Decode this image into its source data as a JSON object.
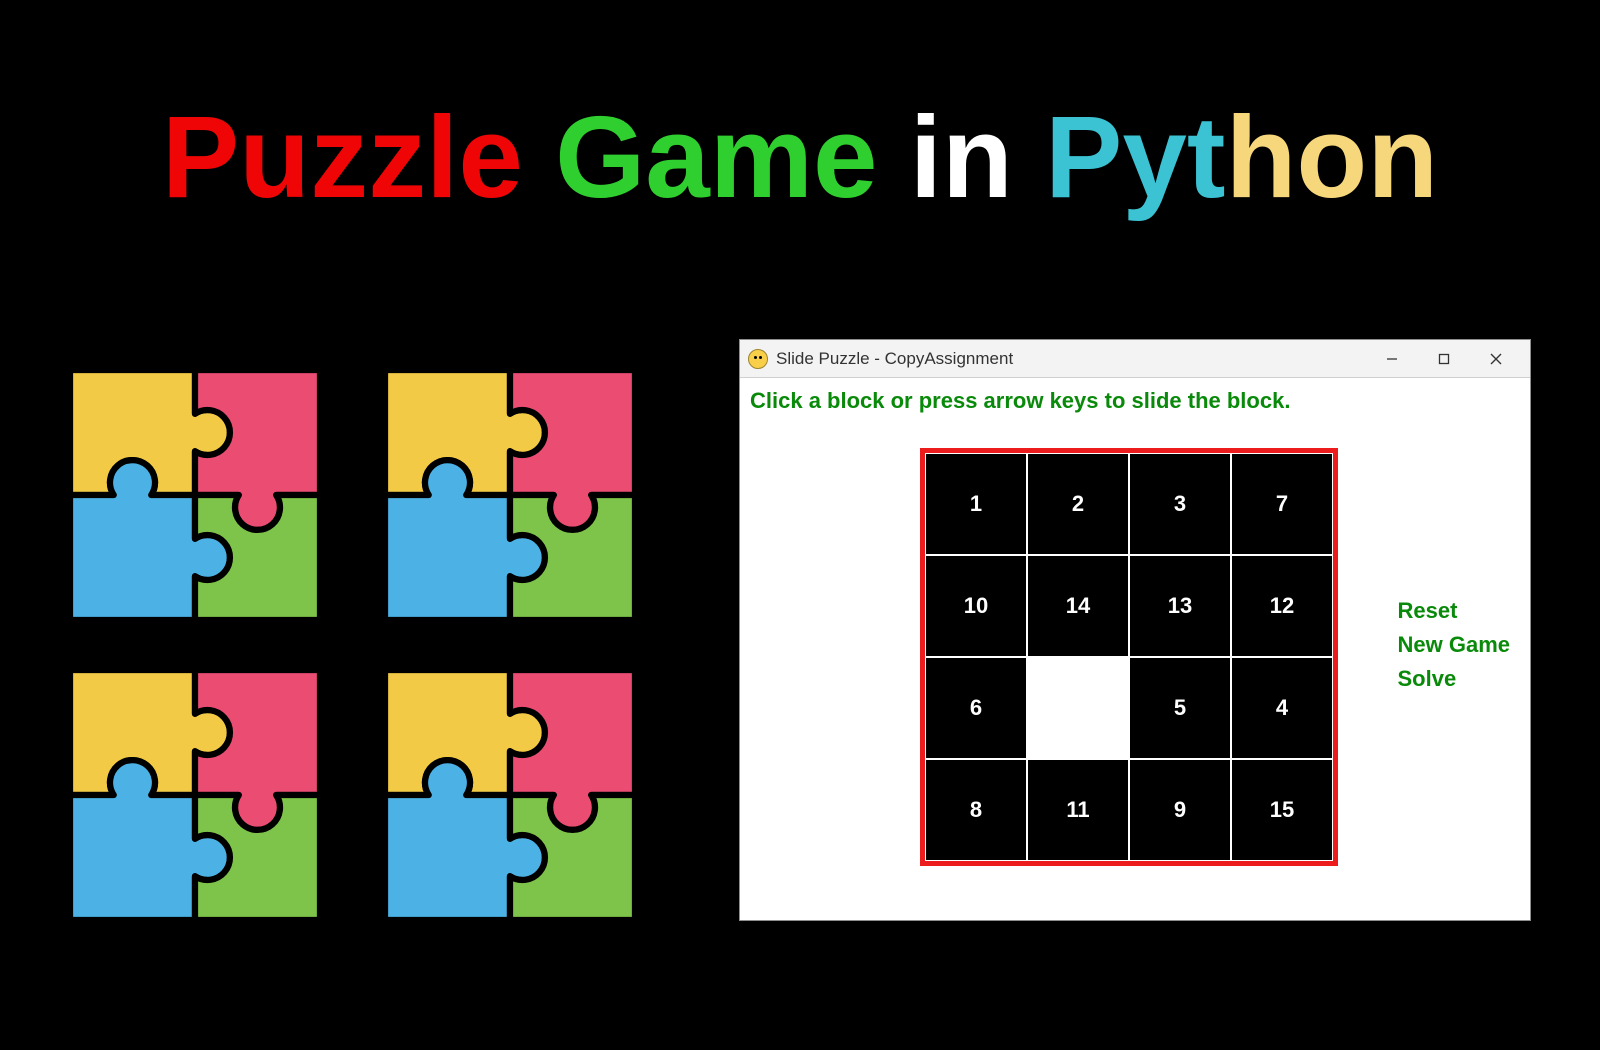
{
  "headline": {
    "word1": "Puzzle",
    "word2": "Game",
    "word3": "in",
    "word4_pyt": "Pyt",
    "word4_hon": "hon"
  },
  "jigsaw": {
    "icon_name": "jigsaw-icon",
    "colors": {
      "tl": "#f3ca45",
      "tr": "#ea4c72",
      "bl": "#4cb2e6",
      "br": "#7fc44a"
    }
  },
  "window": {
    "title": "Slide Puzzle - CopyAssignment",
    "instruction": "Click a block or press arrow keys to slide the block.",
    "controls": {
      "min": "minimize",
      "max": "maximize",
      "close": "close"
    },
    "menu": {
      "reset": "Reset",
      "new_game": "New Game",
      "solve": "Solve"
    },
    "board": {
      "rows": [
        [
          "1",
          "2",
          "3",
          "7"
        ],
        [
          "10",
          "14",
          "13",
          "12"
        ],
        [
          "6",
          "",
          "5",
          "4"
        ],
        [
          "8",
          "11",
          "9",
          "15"
        ]
      ]
    }
  }
}
